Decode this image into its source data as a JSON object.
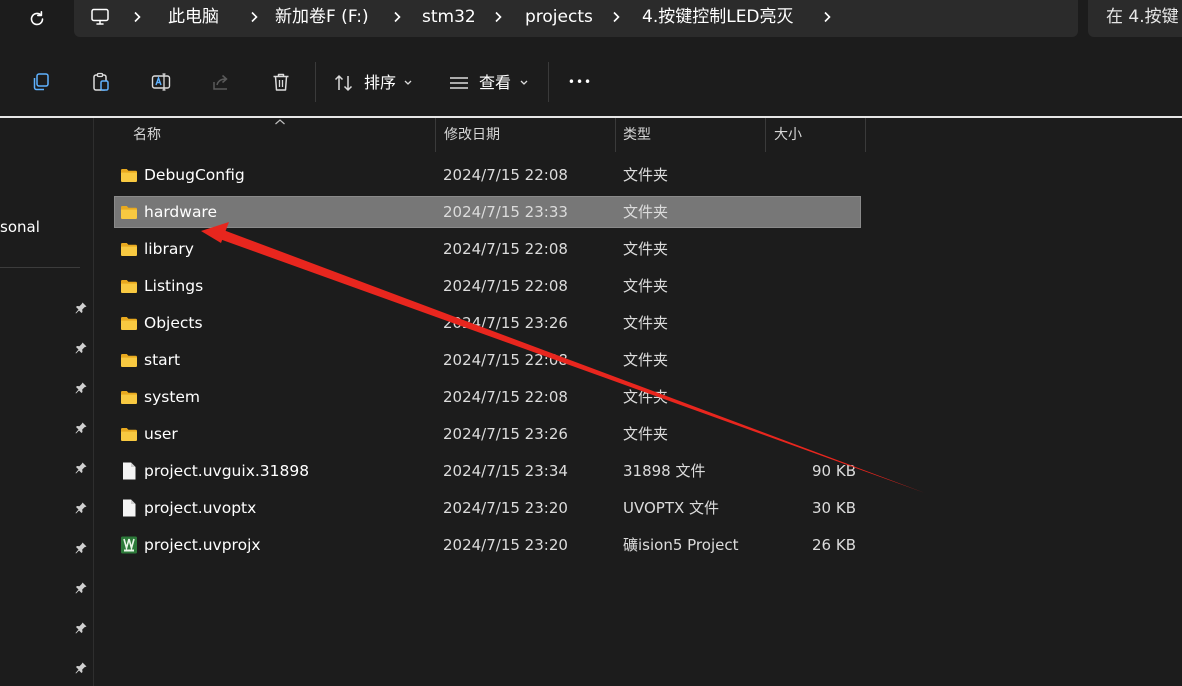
{
  "address_bar": {
    "breadcrumbs": [
      "此电脑",
      "新加卷F (F:)",
      "stm32",
      "projects",
      "4.按键控制LED亮灭"
    ],
    "search_placeholder": "在 4.按键"
  },
  "toolbar": {
    "sort_label": "排序",
    "view_label": "查看",
    "more_label": "•••"
  },
  "sidebar": {
    "truncated_item": "sonal",
    "pinned_count": 10
  },
  "columns": {
    "name": "名称",
    "date": "修改日期",
    "type": "类型",
    "size": "大小"
  },
  "files": [
    {
      "name": "DebugConfig",
      "date": "2024/7/15 22:08",
      "type": "文件夹",
      "size": "",
      "icon": "folder-icon",
      "selected": false
    },
    {
      "name": "hardware",
      "date": "2024/7/15 23:33",
      "type": "文件夹",
      "size": "",
      "icon": "folder-icon",
      "selected": true
    },
    {
      "name": "library",
      "date": "2024/7/15 22:08",
      "type": "文件夹",
      "size": "",
      "icon": "folder-icon",
      "selected": false
    },
    {
      "name": "Listings",
      "date": "2024/7/15 22:08",
      "type": "文件夹",
      "size": "",
      "icon": "folder-icon",
      "selected": false
    },
    {
      "name": "Objects",
      "date": "2024/7/15 23:26",
      "type": "文件夹",
      "size": "",
      "icon": "folder-icon",
      "selected": false
    },
    {
      "name": "start",
      "date": "2024/7/15 22:08",
      "type": "文件夹",
      "size": "",
      "icon": "folder-icon",
      "selected": false
    },
    {
      "name": "system",
      "date": "2024/7/15 22:08",
      "type": "文件夹",
      "size": "",
      "icon": "folder-icon",
      "selected": false
    },
    {
      "name": "user",
      "date": "2024/7/15 23:26",
      "type": "文件夹",
      "size": "",
      "icon": "folder-icon",
      "selected": false
    },
    {
      "name": "project.uvguix.31898",
      "date": "2024/7/15 23:34",
      "type": "31898 文件",
      "size": "90 KB",
      "icon": "file-icon",
      "selected": false
    },
    {
      "name": "project.uvoptx",
      "date": "2024/7/15 23:20",
      "type": "UVOPTX 文件",
      "size": "30 KB",
      "icon": "file-icon",
      "selected": false
    },
    {
      "name": "project.uvprojx",
      "date": "2024/7/15 23:20",
      "type": "礦ision5 Project",
      "size": "26 KB",
      "icon": "keil-project-icon",
      "selected": false
    }
  ],
  "colors": {
    "background": "#1c1c1c",
    "selected_row": "#777777",
    "folder": "#f4c542",
    "annotation_arrow": "#e8261e"
  }
}
